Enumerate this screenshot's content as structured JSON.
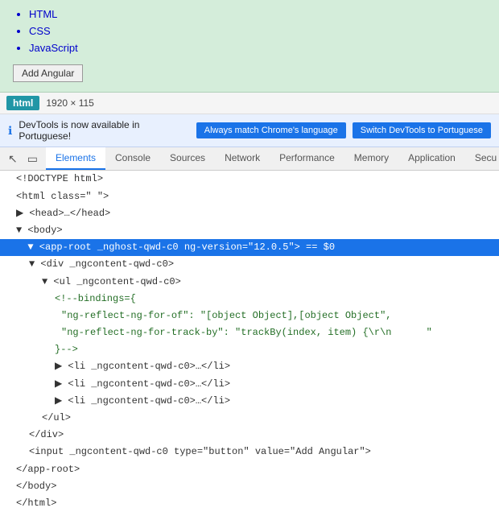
{
  "webpage": {
    "list_items": [
      "HTML",
      "CSS",
      "JavaScript"
    ],
    "add_button_label": "Add Angular"
  },
  "image_bar": {
    "type_label": "html",
    "dimensions": "1920 × 115"
  },
  "lang_banner": {
    "info_text": "DevTools is now available in Portuguese!",
    "match_btn_label": "Always match Chrome's language",
    "switch_btn_label": "Switch DevTools to Portuguese"
  },
  "devtools": {
    "tabs": [
      {
        "label": "Elements",
        "active": true
      },
      {
        "label": "Console",
        "active": false
      },
      {
        "label": "Sources",
        "active": false
      },
      {
        "label": "Network",
        "active": false
      },
      {
        "label": "Performance",
        "active": false
      },
      {
        "label": "Memory",
        "active": false
      },
      {
        "label": "Application",
        "active": false
      },
      {
        "label": "Secu",
        "active": false
      }
    ]
  },
  "code": {
    "lines": [
      {
        "text": "<!DOCTYPE html>",
        "type": "normal",
        "indent": 0
      },
      {
        "text": "<html class=\" \">",
        "type": "normal",
        "indent": 0
      },
      {
        "text": "▶ <head>…</head>",
        "type": "normal",
        "indent": 0
      },
      {
        "text": "▼ <body>",
        "type": "normal",
        "indent": 0
      },
      {
        "text": "▼ <app-root _nghost-qwd-c0 ng-version=\"12.0.5\"> == $0",
        "type": "highlighted",
        "indent": 1
      },
      {
        "text": "▼ <div _ngcontent-qwd-c0>",
        "type": "normal",
        "indent": 2
      },
      {
        "text": "▼ <ul _ngcontent-qwd-c0>",
        "type": "normal",
        "indent": 3
      },
      {
        "text": "<!--bindings={",
        "type": "normal",
        "indent": 4
      },
      {
        "text": "\"ng-reflect-ng-for-of\": \"[object Object],[object Object\",",
        "type": "normal",
        "indent": 4
      },
      {
        "text": "\"ng-reflect-ng-for-track-by\": \"trackBy(index, item) {\\r\\n      \"",
        "type": "normal",
        "indent": 4
      },
      {
        "text": "}-->",
        "type": "normal",
        "indent": 4
      },
      {
        "text": "▶ <li _ngcontent-qwd-c0>…</li>",
        "type": "normal",
        "indent": 4
      },
      {
        "text": "▶ <li _ngcontent-qwd-c0>…</li>",
        "type": "normal",
        "indent": 4
      },
      {
        "text": "▶ <li _ngcontent-qwd-c0>…</li>",
        "type": "normal",
        "indent": 4
      },
      {
        "text": "</ul>",
        "type": "normal",
        "indent": 3
      },
      {
        "text": "</div>",
        "type": "normal",
        "indent": 2
      },
      {
        "text": "<input _ngcontent-qwd-c0 type=\"button\" value=\"Add Angular\">",
        "type": "normal",
        "indent": 2
      },
      {
        "text": "</app-root>",
        "type": "normal",
        "indent": 1
      },
      {
        "text": "</body>",
        "type": "normal",
        "indent": 0
      },
      {
        "text": "</html>",
        "type": "normal",
        "indent": 0
      }
    ]
  }
}
